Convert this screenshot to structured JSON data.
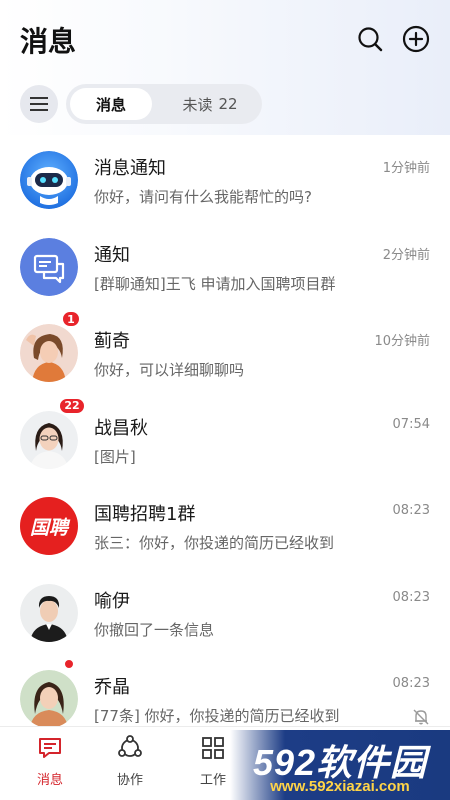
{
  "header": {
    "title": "消息",
    "search_icon": "search-icon",
    "add_icon": "plus-circle-icon"
  },
  "filter": {
    "menu_icon": "hamburger-menu-icon",
    "tabs": [
      {
        "label": "消息",
        "active": true
      },
      {
        "label": "未读",
        "count": "22",
        "active": false
      }
    ]
  },
  "conversations": [
    {
      "name": "消息通知",
      "time": "1分钟前",
      "preview": "你好，请问有什么我能帮忙的吗?",
      "avatar": "robot-avatar"
    },
    {
      "name": "通知",
      "time": "2分钟前",
      "preview": "[群聊通知]王飞 申请加入国聘项目群",
      "avatar": "chat-bubble-avatar"
    },
    {
      "name": "蓟奇",
      "time": "10分钟前",
      "preview": "你好，可以详细聊聊吗",
      "badge": "1",
      "avatar": "user-photo"
    },
    {
      "name": "战昌秋",
      "time": "07:54",
      "preview": "[图片]",
      "badge": "22",
      "avatar": "user-photo"
    },
    {
      "name": "国聘招聘1群",
      "time": "08:23",
      "preview": "张三：你好，你投递的简历已经收到",
      "avatar": "guopin-logo",
      "logo_text": "国聘"
    },
    {
      "name": "喻伊",
      "time": "08:23",
      "preview": "你撤回了一条信息",
      "avatar": "user-photo"
    },
    {
      "name": "乔晶",
      "time": "08:23",
      "preview": "[77条] 你好，你投递的简历已经收到",
      "dot": true,
      "muted": true,
      "avatar": "user-photo"
    }
  ],
  "tabbar": [
    {
      "label": "消息",
      "icon": "message-icon",
      "active": true
    },
    {
      "label": "协作",
      "icon": "collaboration-icon",
      "active": false
    },
    {
      "label": "工作",
      "icon": "grid-icon",
      "active": false
    }
  ],
  "watermark": {
    "main": "592软件园",
    "sub": "www.592xiazai.com"
  },
  "colors": {
    "accent": "#d4242b",
    "badge": "#e8242b",
    "notice_blue": "#5b7fe0"
  }
}
